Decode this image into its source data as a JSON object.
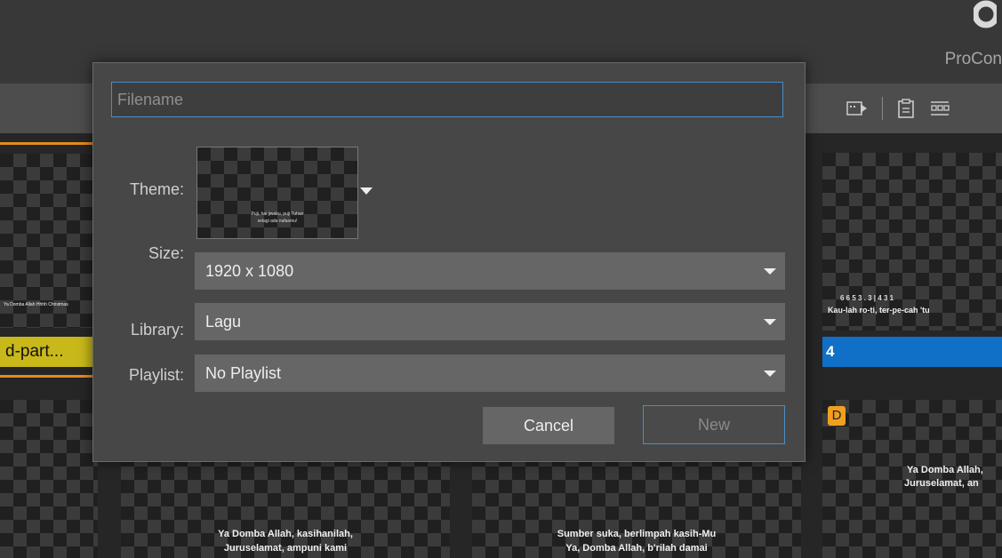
{
  "app": {
    "brand": "ProCon"
  },
  "toolbar": {
    "icons": [
      "media-bin-icon",
      "clipboard-icon",
      "reflow-icon"
    ]
  },
  "slides": {
    "left_top_caption": "Ya Domba Allah Hhhh Christmas",
    "left_top_label": "d-part...",
    "right_top_notation": "6 6 5 3 . 3 | 4 3 1",
    "right_top_lyric": "Kau-lah ro-ti, ter-pe-cah 'tu",
    "right_top_number": "4",
    "right_bottom_badge": "D",
    "bottom_1_line1": "Ya Domba Allah, kasihanilah,",
    "bottom_1_line2": "Juruselamat, ampuni kami",
    "bottom_2_line1": "Sumber suka, berlimpah kasih-Mu",
    "bottom_2_line2": "Ya, Domba Allah, b'rilah damai",
    "bottom_3_line1": "Ya Domba Allah,",
    "bottom_3_line2": "Juruselamat, an"
  },
  "dialog": {
    "filename_placeholder": "Filename",
    "filename_value": "",
    "theme_label": "Theme:",
    "theme_thumb_line1": "Puji, hai jiwaku, puji Tuhan",
    "theme_thumb_line2": "selagi ada nafasmu!",
    "size_label": "Size:",
    "size_value": "1920 x 1080",
    "library_label": "Library:",
    "library_value": "Lagu",
    "playlist_label": "Playlist:",
    "playlist_value": "No Playlist",
    "cancel_label": "Cancel",
    "new_label": "New"
  },
  "colors": {
    "accent_blue": "#1070c8",
    "orange": "#e88a1e",
    "yellow_label": "#c9b81a",
    "badge": "#f0a020"
  }
}
